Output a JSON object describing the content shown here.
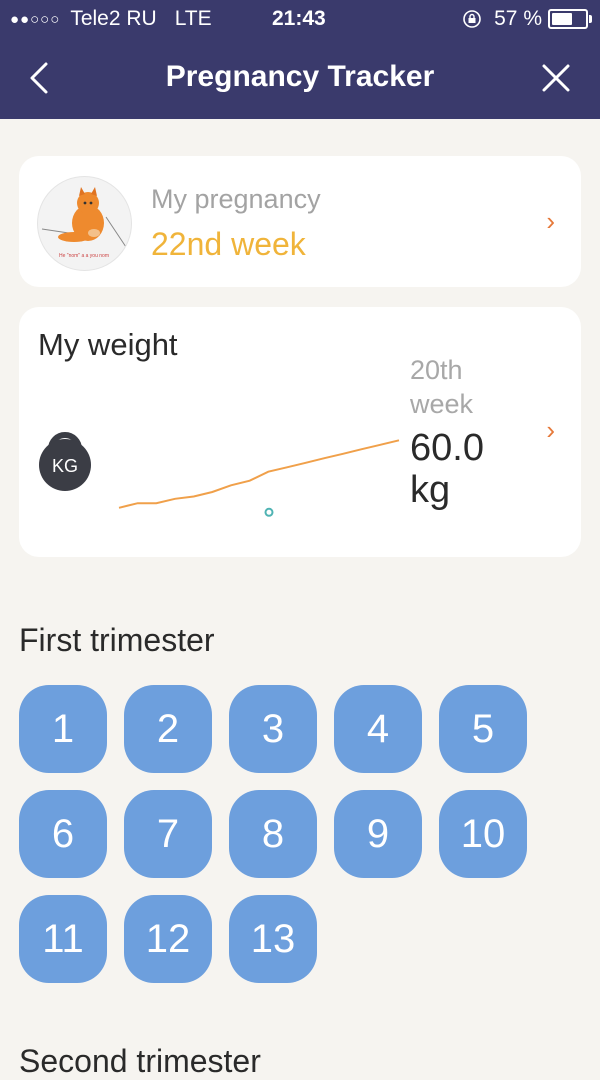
{
  "status_bar": {
    "signal": "●●○○○",
    "carrier": "Tele2 RU",
    "network": "LTE",
    "time": "21:43",
    "battery": "57 %"
  },
  "nav": {
    "title": "Pregnancy Tracker",
    "back_icon": "chevron-left-icon",
    "close_icon": "close-icon"
  },
  "pregnancy_card": {
    "label": "My pregnancy",
    "week": "22nd week",
    "avatar_caption": "He \"nom\" a a you nom"
  },
  "weight_card": {
    "title": "My weight",
    "kettlebell_label": "KG",
    "week": "20th week",
    "value": "60.0 kg",
    "chart_points": [
      57.0,
      57.2,
      57.2,
      57.4,
      57.5,
      57.7,
      58.0,
      58.2,
      58.6,
      58.8,
      59.0,
      59.2,
      59.4,
      59.6,
      59.8,
      60.0
    ],
    "marker_value": 56.8
  },
  "first_trimester": {
    "title": "First trimester",
    "weeks": [
      "1",
      "2",
      "3",
      "4",
      "5",
      "6",
      "7",
      "8",
      "9",
      "10",
      "11",
      "12",
      "13"
    ]
  },
  "next_section": {
    "title": "Second trimester"
  },
  "colors": {
    "header_bg": "#3a3a6c",
    "accent_orange": "#e6793a",
    "week_yellow": "#f0b43a",
    "week_button": "#6d9fdd",
    "background": "#f6f4f0"
  }
}
